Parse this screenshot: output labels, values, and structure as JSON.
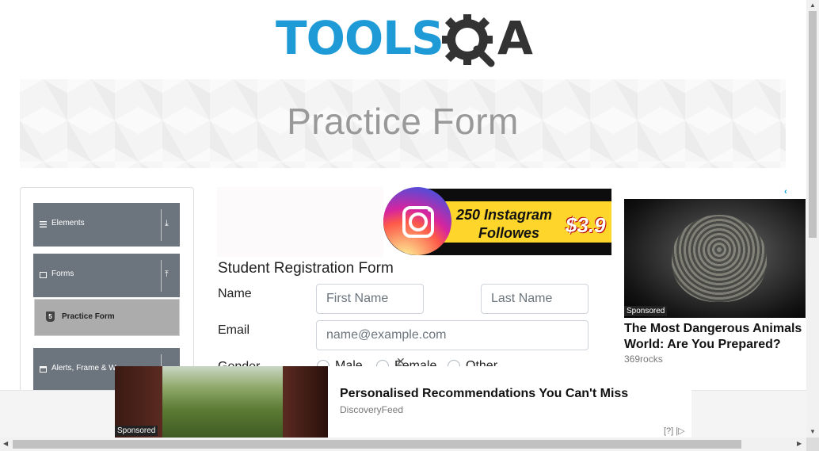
{
  "logo": {
    "text_left": "TOOLS",
    "text_right": "A"
  },
  "banner": {
    "title": "Practice Form"
  },
  "sidebar": {
    "groups": [
      {
        "label": "Elements",
        "arrow": "⤓"
      },
      {
        "label": "Forms",
        "arrow": "⤒"
      },
      {
        "label": "Alerts, Frame & W",
        "arrow": ""
      }
    ],
    "active_item": {
      "label": "Practice Form",
      "icon": "5"
    }
  },
  "insta_ad": {
    "line1": "250 Instagram",
    "line2": "Followes",
    "price": "$3.9"
  },
  "form": {
    "title": "Student Registration Form",
    "name_label": "Name",
    "first_name_placeholder": "First Name",
    "last_name_placeholder": "Last Name",
    "email_label": "Email",
    "email_placeholder": "name@example.com",
    "gender_label": "Gender",
    "gender_options": [
      "Male",
      "Female",
      "Other"
    ]
  },
  "right_ad": {
    "badge": "Sponsored",
    "headline": "The Most Dangerous Animals World: Are You Prepared?",
    "source": "369rocks",
    "adchoice": "‹"
  },
  "bottom_ad": {
    "badge": "Sponsored",
    "headline": "Personalised Recommendations You Can't Miss",
    "source": "DiscoveryFeed",
    "choices": "[?] |▷"
  },
  "colors": {
    "brand_blue": "#1e9bd7",
    "sidebar_header": "#6c757d",
    "active_item": "#acacac"
  }
}
